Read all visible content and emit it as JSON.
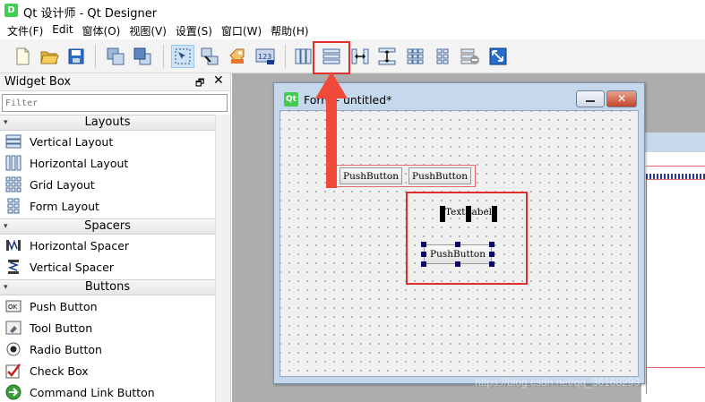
{
  "app": {
    "title": "Qt 设计师 - Qt Designer",
    "icon": "D"
  },
  "menu": [
    "文件(F)",
    "Edit",
    "窗体(O)",
    "视图(V)",
    "设置(S)",
    "窗口(W)",
    "帮助(H)"
  ],
  "toolbar": {
    "icons": [
      "new-file-icon",
      "open-folder-icon",
      "save-icon",
      "send-to-back-icon",
      "bring-to-front-icon",
      "edit-widgets-icon",
      "edit-signals-slots-icon",
      "edit-buddies-icon",
      "edit-tab-order-icon",
      "lay-out-horizontally-icon",
      "lay-out-vertically-icon",
      "lay-out-horizontal-splitter-icon",
      "lay-out-vertical-splitter-icon",
      "lay-out-grid-icon",
      "lay-out-form-icon",
      "break-layout-icon",
      "adjust-size-icon"
    ]
  },
  "widget_box": {
    "title": "Widget Box",
    "filter_placeholder": "Filter",
    "categories": [
      {
        "name": "Layouts",
        "items": [
          "Vertical Layout",
          "Horizontal Layout",
          "Grid Layout",
          "Form Layout"
        ]
      },
      {
        "name": "Spacers",
        "items": [
          "Horizontal Spacer",
          "Vertical Spacer"
        ]
      },
      {
        "name": "Buttons",
        "items": [
          "Push Button",
          "Tool Button",
          "Radio Button",
          "Check Box",
          "Command Link Button"
        ]
      }
    ]
  },
  "form": {
    "title": "Form - untitled*",
    "qt_badge": "Qt",
    "layout_buttons": [
      "PushButton",
      "PushButton"
    ],
    "selected_label": "TextLabel",
    "selected_button": "PushButton"
  },
  "watermark": "https://blog.csdn.net/qq_36168299",
  "colors": {
    "highlight": "#e0302e",
    "layout_border": "#e06a6a",
    "qt_green": "#41cd52"
  }
}
